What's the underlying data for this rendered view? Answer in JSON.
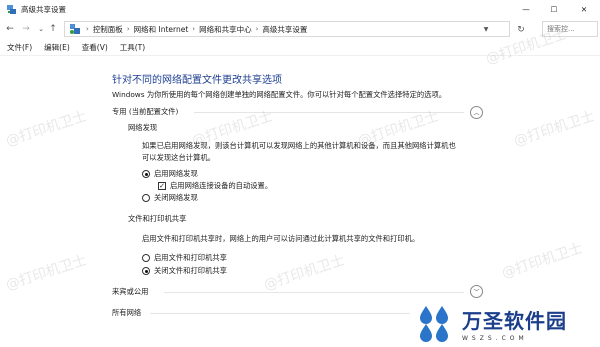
{
  "window": {
    "title": "高级共享设置",
    "minimize_glyph": "—",
    "maximize_glyph": "☐",
    "close_glyph": "✕"
  },
  "address": {
    "crumbs": [
      "控制面板",
      "网络和 Internet",
      "网络和共享中心",
      "高级共享设置"
    ],
    "search_placeholder": "搜索控..."
  },
  "menu": {
    "items": [
      "文件(F)",
      "编辑(E)",
      "查看(V)",
      "工具(T)"
    ]
  },
  "main": {
    "heading": "针对不同的网络配置文件更改共享选项",
    "description": "Windows 为你所使用的每个网络创建单独的网络配置文件。你可以针对每个配置文件选择特定的选项。",
    "profile_private": {
      "title": "专用 (当前配置文件)",
      "network_discovery": {
        "title": "网络发现",
        "text_line1": "如果已启用网络发现，则该台计算机可以发现网络上的其他计算机和设备，而且其他网络计算机也",
        "text_line2": "可以发现这台计算机。",
        "opt_on": "启用网络发现",
        "opt_auto": "启用网络连接设备的自动设置。",
        "opt_off": "关闭网络发现",
        "selected": "on",
        "auto_checked": true
      },
      "file_printer_sharing": {
        "title": "文件和打印机共享",
        "text": "启用文件和打印机共享时，网络上的用户可以访问通过此计算机共享的文件和打印机。",
        "opt_on": "启用文件和打印机共享",
        "opt_off": "关闭文件和打印机共享",
        "selected": "off"
      }
    },
    "profile_guest": {
      "title": "来宾或公用"
    },
    "profile_all": {
      "title": "所有网络"
    }
  },
  "watermark": {
    "text": "@打印机卫士"
  },
  "logo": {
    "name": "万圣软件园",
    "url": "WSZS.COM"
  },
  "colors": {
    "heading": "#1e3f92",
    "logo": "#1c3f8c"
  }
}
